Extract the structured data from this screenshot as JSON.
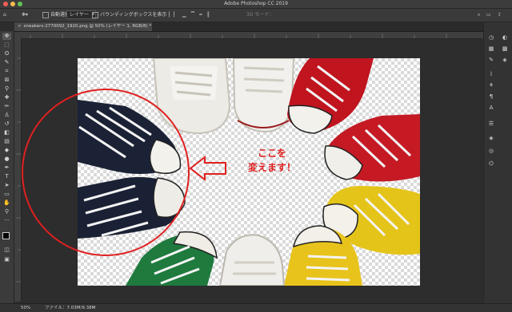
{
  "window": {
    "title": "Adobe Photoshop CC 2019"
  },
  "options_bar": {
    "auto_select_label": "自動選択：",
    "auto_select_value": "レイヤー",
    "transform_controls_label": "バウンディングボックスを表示",
    "mode_3d_label": "3D モード："
  },
  "document_tab": {
    "label": "sneakers-2770092_1920.png @ 50% (レイヤー 1, RGB/8) *"
  },
  "annotation": {
    "line1": "ここを",
    "line2": "変えます！"
  },
  "status_bar": {
    "zoom": "50%",
    "file_info": "ファイル：7.03M/9.38M"
  },
  "colors": {
    "annotation_red": "#e02020",
    "ui_dark": "#2d2d2d"
  },
  "icons": {
    "tools": [
      "move-icon",
      "marquee-icon",
      "lasso-icon",
      "quick-select-icon",
      "crop-icon",
      "frame-icon",
      "eyedropper-icon",
      "healing-brush-icon",
      "brush-icon",
      "clone-stamp-icon",
      "history-brush-icon",
      "eraser-icon",
      "gradient-icon",
      "blur-icon",
      "dodge-icon",
      "pen-icon",
      "type-icon",
      "path-select-icon",
      "rectangle-icon",
      "hand-icon",
      "zoom-icon",
      "more-tools-icon"
    ],
    "panels": [
      "history-icon",
      "adjustments-icon",
      "libraries-icon",
      "brush-settings-icon",
      "paragraph-icon",
      "character-icon",
      "properties-icon",
      "layers-icon",
      "channels-icon",
      "paths-icon"
    ]
  }
}
